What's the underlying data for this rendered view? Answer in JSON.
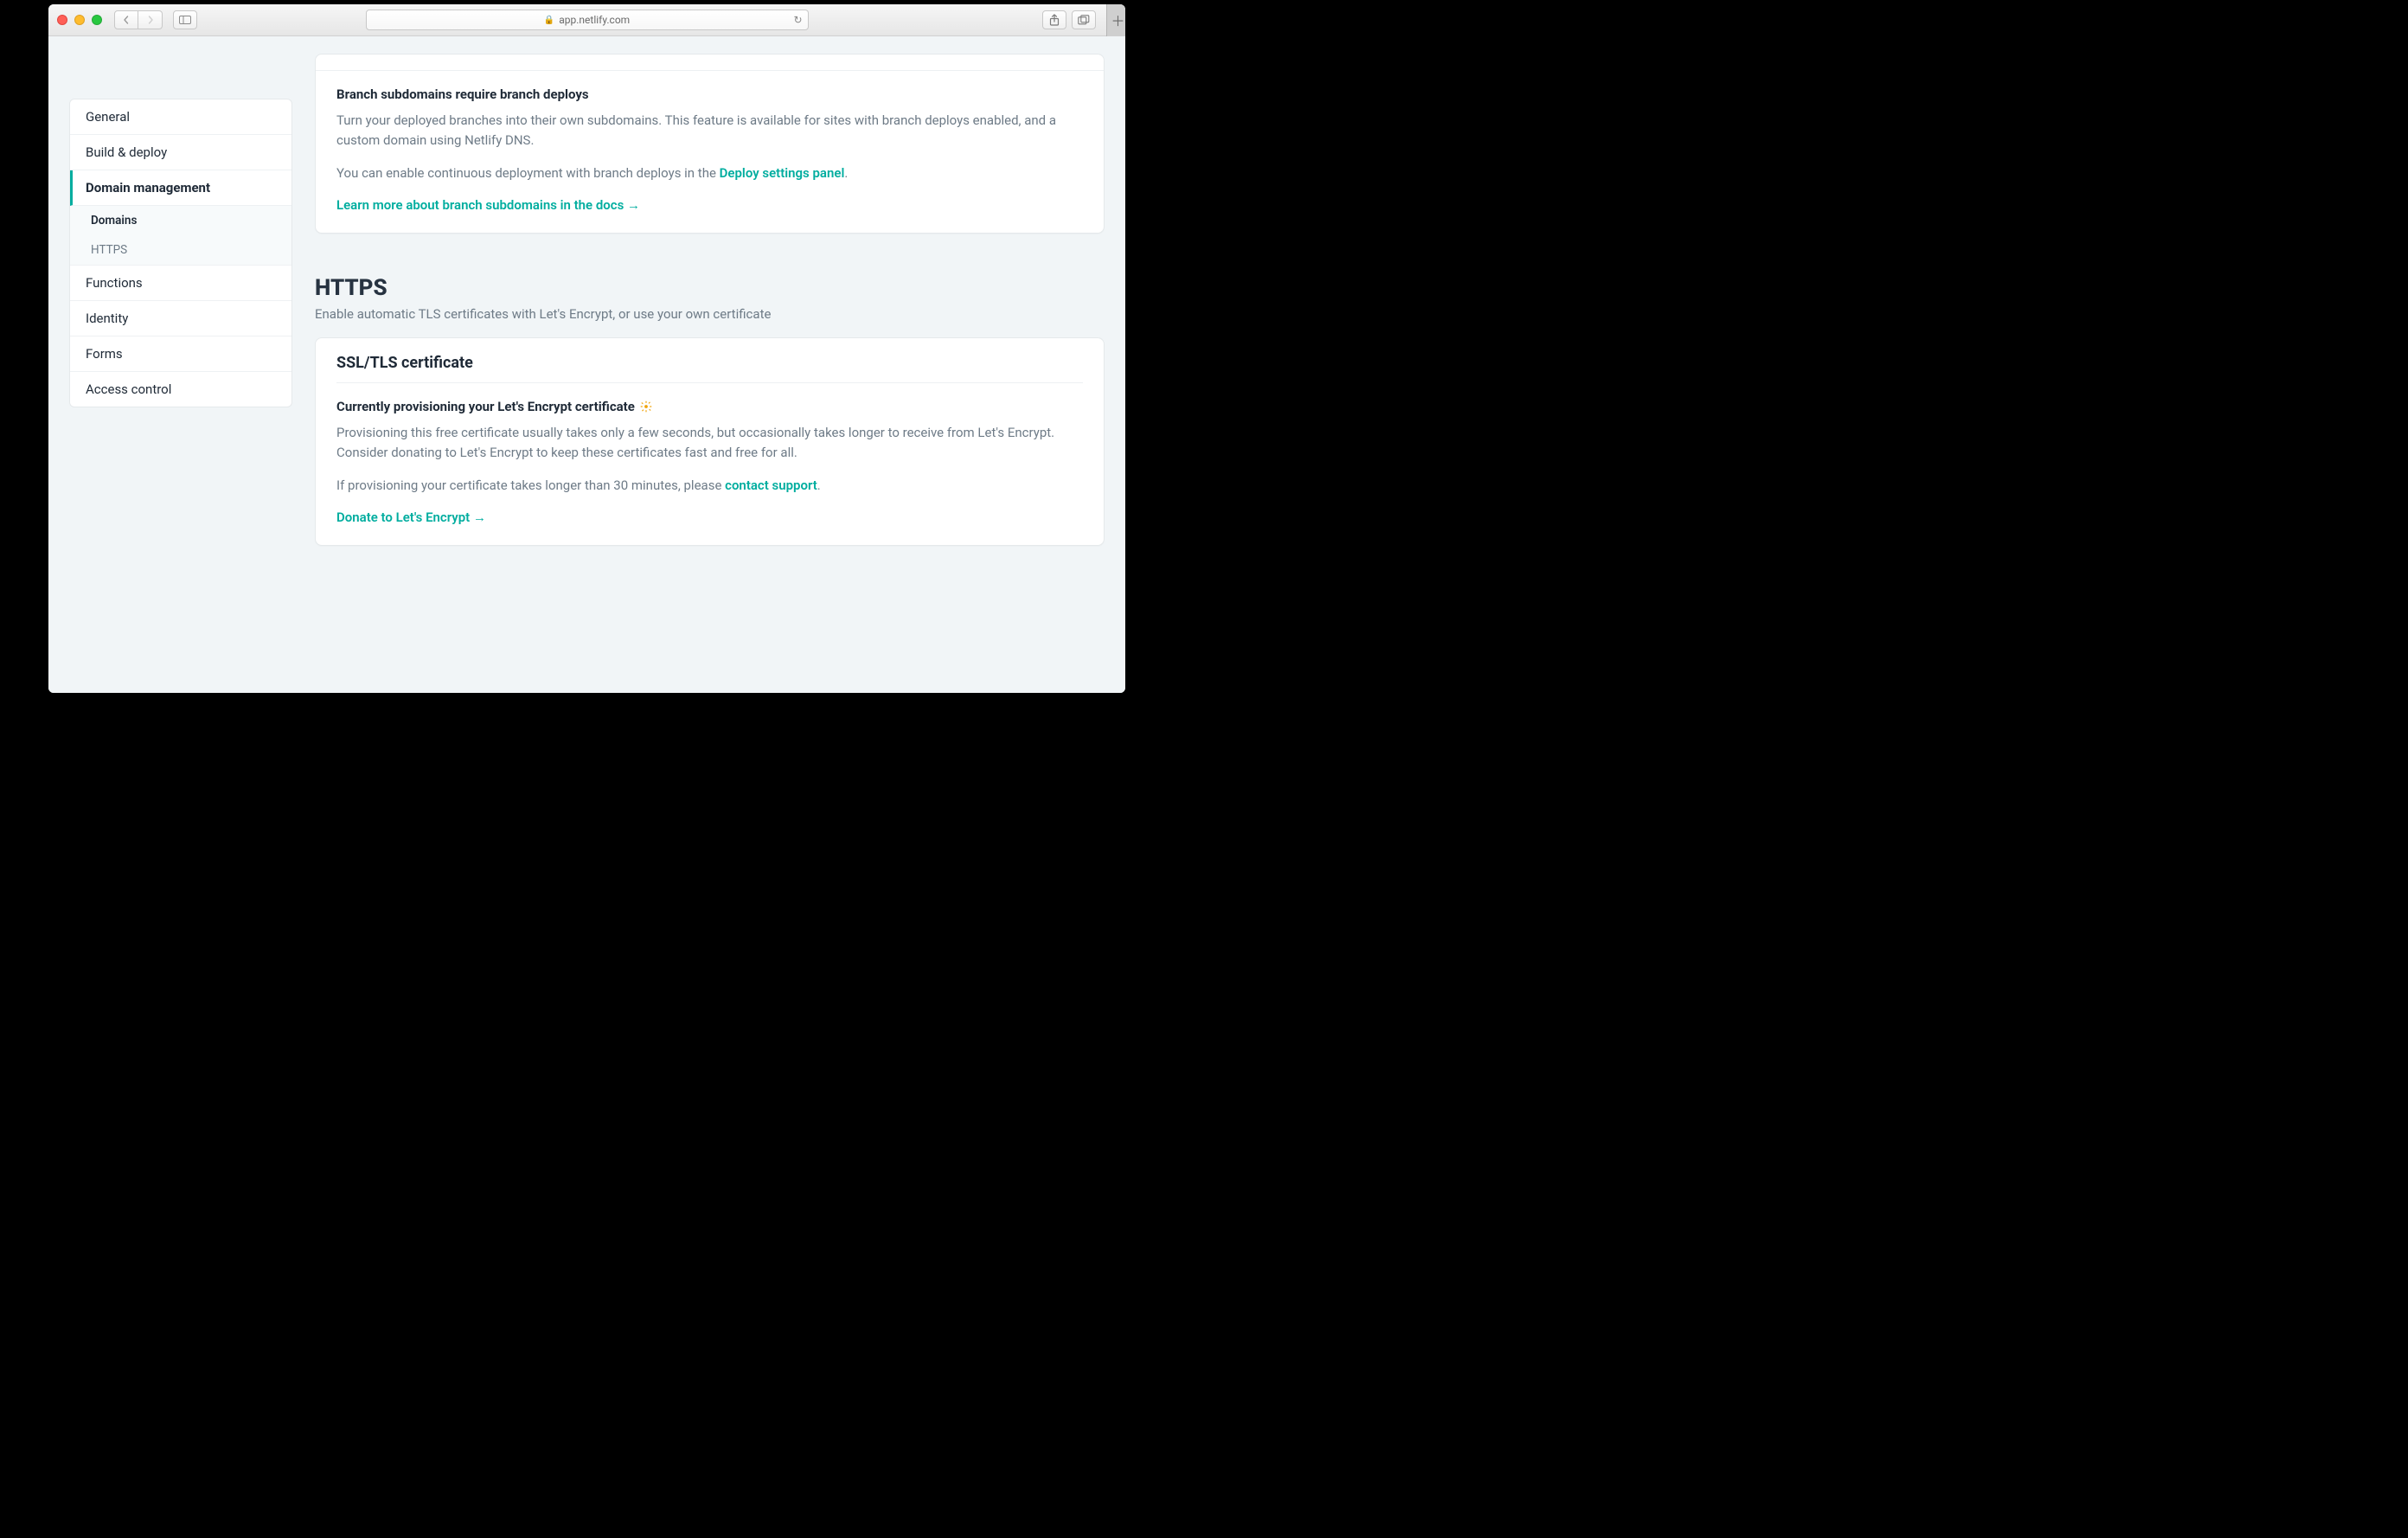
{
  "browser": {
    "url_host": "app.netlify.com"
  },
  "sidebar": {
    "items": [
      {
        "label": "General"
      },
      {
        "label": "Build & deploy"
      },
      {
        "label": "Domain management",
        "active": true
      },
      {
        "label": "Functions"
      },
      {
        "label": "Identity"
      },
      {
        "label": "Forms"
      },
      {
        "label": "Access control"
      }
    ],
    "sub": [
      {
        "label": "Domains",
        "selected": true
      },
      {
        "label": "HTTPS",
        "selected": false
      }
    ]
  },
  "branch_card": {
    "title": "Branch subdomains require branch deploys",
    "p1": "Turn your deployed branches into their own subdomains. This feature is available for sites with branch deploys enabled, and a custom domain using Netlify DNS.",
    "p2_prefix": "You can enable continuous deployment with branch deploys in the ",
    "p2_link": "Deploy settings panel",
    "p2_suffix": ".",
    "learn_more": "Learn more about branch subdomains in the docs"
  },
  "https_section": {
    "title": "HTTPS",
    "subtitle": "Enable automatic TLS certificates with Let's Encrypt, or use your own certificate"
  },
  "ssl_card": {
    "heading": "SSL/TLS certificate",
    "status_title": "Currently provisioning your Let's Encrypt certificate",
    "p1": "Provisioning this free certificate usually takes only a few seconds, but occasionally takes longer to receive from Let's Encrypt. Consider donating to Let's Encrypt to keep these certificates fast and free for all.",
    "p2_prefix": "If provisioning your certificate takes longer than 30 minutes, please ",
    "p2_link": "contact support",
    "p2_suffix": ".",
    "donate": "Donate to Let's Encrypt"
  }
}
